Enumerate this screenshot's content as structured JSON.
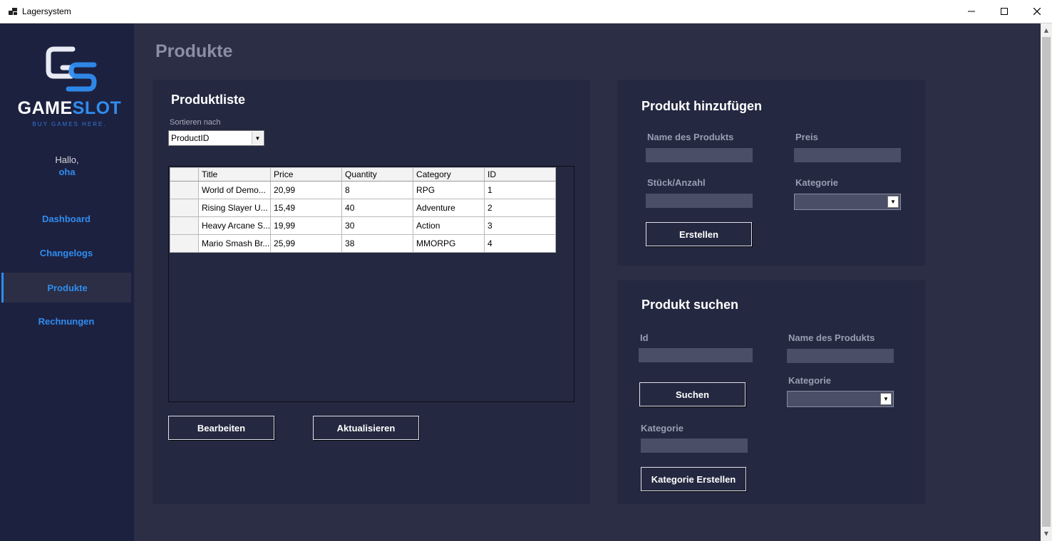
{
  "window": {
    "title": "Lagersystem",
    "minimize": "—",
    "maximize": "☐",
    "close": "✕"
  },
  "sidebar": {
    "logo_word_a": "GAME",
    "logo_word_b": "SLOT",
    "logo_tagline": "BUY GAMES HERE.",
    "greeting": "Hallo,",
    "username": "oha",
    "items": [
      {
        "label": "Dashboard"
      },
      {
        "label": "Changelogs"
      },
      {
        "label": "Produkte"
      },
      {
        "label": "Rechnungen"
      }
    ],
    "active_item": "Produkte"
  },
  "page": {
    "title": "Produkte"
  },
  "product_list": {
    "title": "Produktliste",
    "sort_label": "Sortieren nach",
    "sort_value": "ProductID",
    "columns": [
      "Title",
      "Price",
      "Quantity",
      "Category",
      "ID"
    ],
    "rows": [
      {
        "title": "World of Demo...",
        "price": "20,99",
        "quantity": "8",
        "category": "RPG",
        "id": "1"
      },
      {
        "title": "Rising Slayer U...",
        "price": "15,49",
        "quantity": "40",
        "category": "Adventure",
        "id": "2"
      },
      {
        "title": "Heavy Arcane S...",
        "price": "19,99",
        "quantity": "30",
        "category": "Action",
        "id": "3"
      },
      {
        "title": "Mario Smash Br...",
        "price": "25,99",
        "quantity": "38",
        "category": "MMORPG",
        "id": "4"
      }
    ],
    "edit_button": "Bearbeiten",
    "refresh_button": "Aktualisieren"
  },
  "add_product": {
    "title": "Produkt hinzufügen",
    "name_label": "Name des Produkts",
    "name_value": "",
    "price_label": "Preis",
    "price_value": "",
    "quantity_label": "Stück/Anzahl",
    "quantity_value": "",
    "category_label": "Kategorie",
    "category_value": "",
    "create_button": "Erstellen"
  },
  "search_product": {
    "title": "Produkt suchen",
    "id_label": "Id",
    "id_value": "",
    "name_label": "Name des Produkts",
    "name_value": "",
    "category_label": "Kategorie",
    "category_value": "",
    "search_button": "Suchen",
    "new_category_label": "Kategorie",
    "new_category_value": "",
    "create_category_button": "Kategorie Erstellen"
  },
  "colors": {
    "accent": "#2f8df0",
    "sidebar_bg": "#1d2140",
    "main_bg": "#2b2e44",
    "panel_bg": "#242840"
  }
}
